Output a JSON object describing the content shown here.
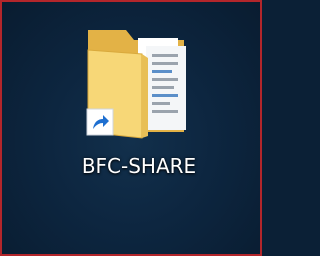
{
  "desktop": {
    "icons": [
      {
        "label": "BFC-SHARE",
        "icon": "folder-icon",
        "shortcut": true,
        "overlay_icon": "shortcut-arrow-icon"
      }
    ]
  },
  "colors": {
    "desktop_background": "#0d2640",
    "window_border": "#b3262b",
    "folder_body": "#f0c85a",
    "folder_front": "#f7d777",
    "label_text": "#ffffff",
    "shortcut_arrow": "#1e6fd0"
  }
}
